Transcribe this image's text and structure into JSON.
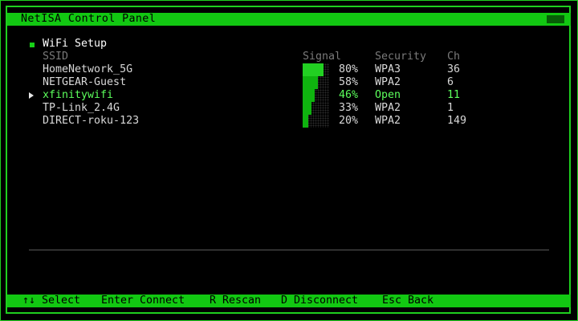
{
  "window": {
    "title": "NetISA Control Panel"
  },
  "section": {
    "title": "WiFi Setup"
  },
  "columns": {
    "ssid": "SSID",
    "signal": "Signal",
    "security": "Security",
    "channel": "Ch"
  },
  "networks": [
    {
      "ssid": "HomeNetwork_5G",
      "signal_pct": 80,
      "signal_text": "80%",
      "security": "WPA3",
      "channel": "36"
    },
    {
      "ssid": "NETGEAR-Guest",
      "signal_pct": 58,
      "signal_text": "58%",
      "security": "WPA2",
      "channel": "6"
    },
    {
      "ssid": "xfinitywifi",
      "signal_pct": 46,
      "signal_text": "46%",
      "security": "Open",
      "channel": "11",
      "selected": true
    },
    {
      "ssid": "TP-Link_2.4G",
      "signal_pct": 33,
      "signal_text": "33%",
      "security": "WPA2",
      "channel": "1"
    },
    {
      "ssid": "DIRECT-roku-123",
      "signal_pct": 20,
      "signal_text": "20%",
      "security": "WPA2",
      "channel": "149"
    }
  ],
  "footer": {
    "select": "↑↓ Select",
    "connect": "Enter Connect",
    "rescan": "R Rescan",
    "disconnect": "D Disconnect",
    "back": "Esc Back"
  },
  "colors": {
    "accent": "#12c812",
    "selected_text": "#5cff5c",
    "header_text": "#7a7a7a",
    "background": "#000000"
  }
}
